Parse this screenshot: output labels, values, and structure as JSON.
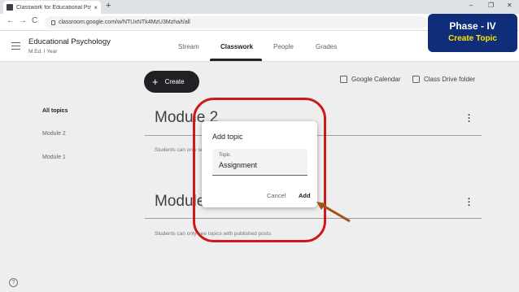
{
  "browser": {
    "tab_title": "Classwork for Educational Psycho",
    "tab_close": "×",
    "new_tab": "+",
    "window_controls": [
      "–",
      "❐",
      "✕"
    ],
    "nav": [
      "←",
      "→",
      "C"
    ],
    "url": "classroom.google.com/w/NTUxNTk4MzU3Mzha/t/all"
  },
  "class": {
    "name": "Educational Psychology",
    "subtitle": "M.Ed. I Year"
  },
  "nav_tabs": [
    "Stream",
    "Classwork",
    "People",
    "Grades"
  ],
  "active_tab": "Classwork",
  "badge": {
    "line1": "Phase - IV",
    "line2": "Create Topic",
    "bg_color": "#102d7a",
    "accent_color": "#ffe400"
  },
  "toolbar": {
    "create_label": "Create",
    "google_calendar": "Google Calendar",
    "drive_folder": "Class Drive folder"
  },
  "sidebar": {
    "items": [
      "All topics",
      "Module 2",
      "Module 1"
    ]
  },
  "modules": [
    {
      "title": "Module 2",
      "note": "Students can only see topics with published posts"
    },
    {
      "title": "Module 1",
      "note": "Students can only see topics with published posts"
    }
  ],
  "dialog": {
    "title": "Add topic",
    "field_label": "Topic",
    "field_value": "Assignment",
    "cancel_label": "Cancel",
    "add_label": "Add"
  },
  "help_label": "?",
  "annotation_color": "#d01818"
}
